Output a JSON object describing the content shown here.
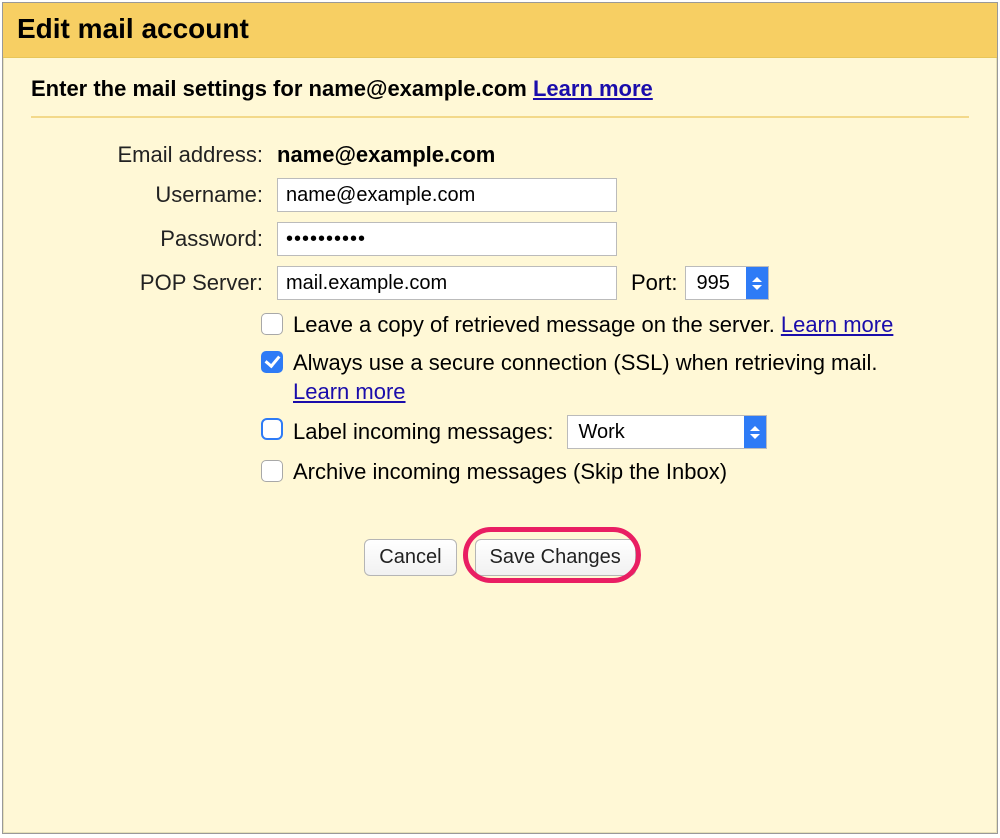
{
  "title": "Edit mail account",
  "intro": {
    "prefix": "Enter the mail settings for",
    "email": "name@example.com",
    "learn_more": "Learn more"
  },
  "fields": {
    "email_label": "Email address:",
    "email_value": "name@example.com",
    "username_label": "Username:",
    "username_value": "name@example.com",
    "password_label": "Password:",
    "password_value": "••••••••••",
    "pop_label": "POP Server:",
    "pop_value": "mail.example.com",
    "port_label": "Port:",
    "port_value": "995"
  },
  "options": {
    "leave_copy": {
      "text": "Leave a copy of retrieved message on the server.",
      "learn_more": "Learn more",
      "checked": false
    },
    "ssl": {
      "text": "Always use a secure connection (SSL) when retrieving mail.",
      "learn_more": "Learn more",
      "checked": true
    },
    "label_incoming": {
      "text": "Label incoming messages:",
      "select_value": "Work",
      "checked": false
    },
    "archive": {
      "text": "Archive incoming messages (Skip the Inbox)",
      "checked": false
    }
  },
  "buttons": {
    "cancel": "Cancel",
    "save": "Save Changes"
  }
}
